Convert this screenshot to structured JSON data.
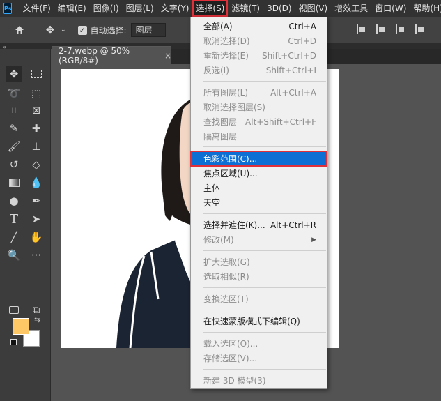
{
  "app": {
    "logo": "Ps"
  },
  "menubar": {
    "items": [
      {
        "label": "文件(F)"
      },
      {
        "label": "编辑(E)"
      },
      {
        "label": "图像(I)"
      },
      {
        "label": "图层(L)"
      },
      {
        "label": "文字(Y)"
      },
      {
        "label": "选择(S)"
      },
      {
        "label": "滤镜(T)"
      },
      {
        "label": "3D(D)"
      },
      {
        "label": "视图(V)"
      },
      {
        "label": "增效工具"
      },
      {
        "label": "窗口(W)"
      },
      {
        "label": "帮助(H)"
      }
    ]
  },
  "options": {
    "auto_select_label": "自动选择:",
    "layer_select_value": "图层",
    "auto_select_checked": true
  },
  "document": {
    "tab_title": "2-7.webp @ 50%(RGB/8#)",
    "close": "×"
  },
  "colors": {
    "foreground": "#ffc866",
    "background": "#ffffff",
    "highlight": "#0d6fd4",
    "annotation": "#e0303a"
  },
  "select_menu": {
    "items": [
      {
        "label": "全部(A)",
        "shortcut": "Ctrl+A",
        "disabled": false
      },
      {
        "label": "取消选择(D)",
        "shortcut": "Ctrl+D",
        "disabled": true
      },
      {
        "label": "重新选择(E)",
        "shortcut": "Shift+Ctrl+D",
        "disabled": true
      },
      {
        "label": "反选(I)",
        "shortcut": "Shift+Ctrl+I",
        "disabled": true
      },
      {
        "label": "所有图层(L)",
        "shortcut": "Alt+Ctrl+A",
        "disabled": true
      },
      {
        "label": "取消选择图层(S)",
        "shortcut": "",
        "disabled": true
      },
      {
        "label": "查找图层",
        "shortcut": "Alt+Shift+Ctrl+F",
        "disabled": true
      },
      {
        "label": "隔离图层",
        "shortcut": "",
        "disabled": true
      },
      {
        "label": "色彩范围(C)...",
        "shortcut": "",
        "disabled": false,
        "highlighted": true
      },
      {
        "label": "焦点区域(U)...",
        "shortcut": "",
        "disabled": false
      },
      {
        "label": "主体",
        "shortcut": "",
        "disabled": false
      },
      {
        "label": "天空",
        "shortcut": "",
        "disabled": false
      },
      {
        "label": "选择并遮住(K)...",
        "shortcut": "Alt+Ctrl+R",
        "disabled": false
      },
      {
        "label": "修改(M)",
        "shortcut": "",
        "disabled": true,
        "submenu": true
      },
      {
        "label": "扩大选取(G)",
        "shortcut": "",
        "disabled": true
      },
      {
        "label": "选取相似(R)",
        "shortcut": "",
        "disabled": true
      },
      {
        "label": "变换选区(T)",
        "shortcut": "",
        "disabled": true
      },
      {
        "label": "在快速蒙版模式下编辑(Q)",
        "shortcut": "",
        "disabled": false
      },
      {
        "label": "载入选区(O)...",
        "shortcut": "",
        "disabled": true
      },
      {
        "label": "存储选区(V)...",
        "shortcut": "",
        "disabled": true
      },
      {
        "label": "新建 3D 模型(3)",
        "shortcut": "",
        "disabled": true
      }
    ]
  }
}
